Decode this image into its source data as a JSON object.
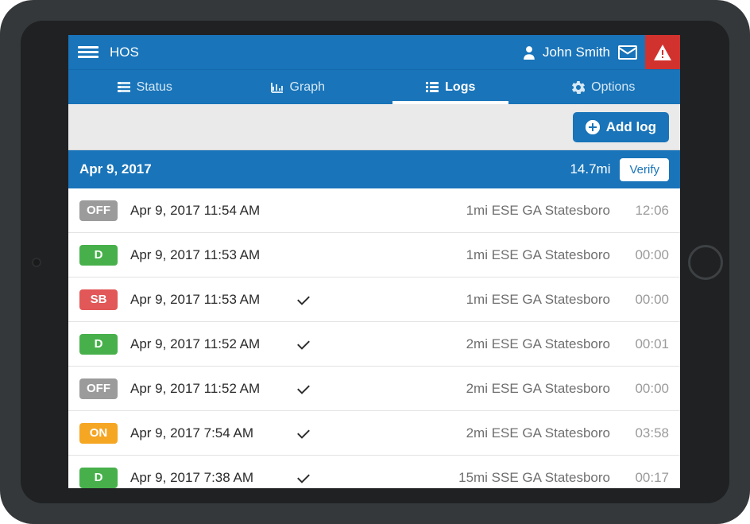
{
  "brand": "HOS",
  "user_name": "John Smith",
  "tabs": {
    "status": "Status",
    "graph": "Graph",
    "logs": "Logs",
    "options": "Options"
  },
  "toolbar": {
    "add_log": "Add log"
  },
  "group": {
    "date": "Apr 9, 2017",
    "distance": "14.7mi",
    "verify": "Verify"
  },
  "logs": [
    {
      "status": "OFF",
      "badge_class": "off",
      "timestamp": "Apr 9, 2017 11:54 AM",
      "verified": false,
      "location": "1mi ESE GA Statesboro",
      "duration": "12:06"
    },
    {
      "status": "D",
      "badge_class": "d",
      "timestamp": "Apr 9, 2017 11:53 AM",
      "verified": false,
      "location": "1mi ESE GA Statesboro",
      "duration": "00:00"
    },
    {
      "status": "SB",
      "badge_class": "sb",
      "timestamp": "Apr 9, 2017 11:53 AM",
      "verified": true,
      "location": "1mi ESE GA Statesboro",
      "duration": "00:00"
    },
    {
      "status": "D",
      "badge_class": "d",
      "timestamp": "Apr 9, 2017 11:52 AM",
      "verified": true,
      "location": "2mi ESE GA Statesboro",
      "duration": "00:01"
    },
    {
      "status": "OFF",
      "badge_class": "off",
      "timestamp": "Apr 9, 2017 11:52 AM",
      "verified": true,
      "location": "2mi ESE GA Statesboro",
      "duration": "00:00"
    },
    {
      "status": "ON",
      "badge_class": "on",
      "timestamp": "Apr 9, 2017 7:54 AM",
      "verified": true,
      "location": "2mi ESE GA Statesboro",
      "duration": "03:58"
    },
    {
      "status": "D",
      "badge_class": "d",
      "timestamp": "Apr 9, 2017 7:38 AM",
      "verified": true,
      "location": "15mi SSE GA Statesboro",
      "duration": "00:17"
    }
  ]
}
